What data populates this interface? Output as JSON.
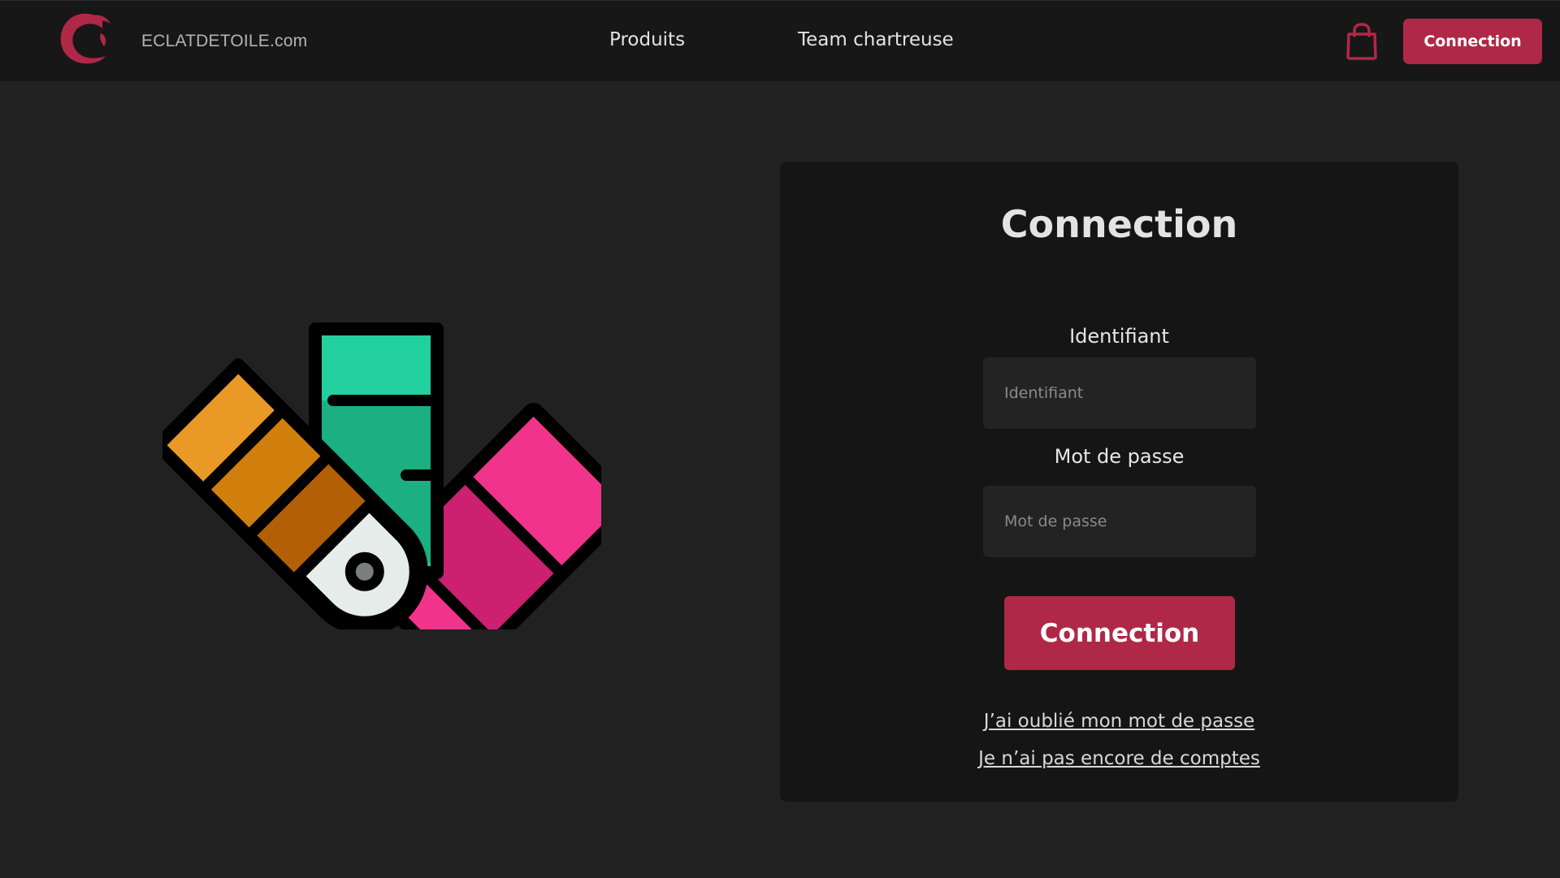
{
  "header": {
    "brand": "ECLATDETOILE.com",
    "nav": [
      "Produits",
      "Team chartreuse"
    ],
    "login_button": "Connection",
    "logo_icon": "crescent-logo-icon",
    "cart_icon": "shopping-bag-icon"
  },
  "illustration": {
    "icon": "color-swatch-fan-icon",
    "colors": [
      "#e99a26",
      "#d07f0d",
      "#b35f05",
      "#22cf9e",
      "#1baf81",
      "#f2338c",
      "#cc2070"
    ]
  },
  "login_form": {
    "title": "Connection",
    "username_label": "Identifiant",
    "username_placeholder": "Identifiant",
    "password_label": "Mot de passe",
    "password_placeholder": "Mot de passe",
    "submit": "Connection",
    "forgot_link": "J’ai oublié mon mot de passe",
    "signup_link": "Je n’ai pas encore de comptes"
  },
  "colors": {
    "accent": "#b02847",
    "background": "#212121",
    "header": "#171717",
    "card": "#151515"
  }
}
